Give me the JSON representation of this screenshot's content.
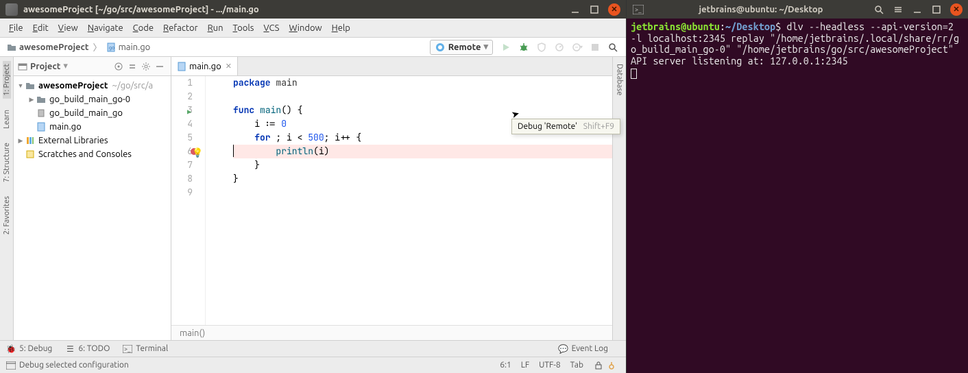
{
  "ide": {
    "title": "awesomeProject [~/go/src/awesomeProject] - .../main.go",
    "menus": [
      "File",
      "Edit",
      "View",
      "Navigate",
      "Code",
      "Refactor",
      "Run",
      "Tools",
      "VCS",
      "Window",
      "Help"
    ],
    "breadcrumbs": [
      {
        "label": "awesomeProject",
        "icon": "folder-icon"
      },
      {
        "label": "main.go",
        "icon": "go-file-icon"
      }
    ],
    "run_config": {
      "label": "Remote",
      "icon": "go-remote-icon"
    },
    "toolbar_icons": [
      {
        "name": "run-button",
        "title": "Run",
        "color": "#59a869",
        "disabled": true
      },
      {
        "name": "debug-button",
        "title": "Debug",
        "color": "#499c54",
        "disabled": false
      },
      {
        "name": "coverage-button",
        "title": "Coverage",
        "color": "#888",
        "disabled": true
      },
      {
        "name": "profile-button",
        "title": "Profile",
        "color": "#888",
        "disabled": true
      },
      {
        "name": "attach-button",
        "title": "Attach",
        "color": "#888",
        "disabled": true
      },
      {
        "name": "stop-button",
        "title": "Stop",
        "color": "#888",
        "disabled": true
      },
      {
        "name": "search-button",
        "title": "Search Everywhere",
        "color": "#555",
        "disabled": false
      }
    ],
    "tooltip": {
      "text": "Debug 'Remote'",
      "shortcut": "Shift+F9"
    },
    "left_stripe": [
      {
        "label": "1: Project",
        "active": true
      },
      {
        "label": "Learn",
        "active": false
      },
      {
        "label": "7: Structure",
        "active": false
      },
      {
        "label": "2: Favorites",
        "active": false
      }
    ],
    "right_stripe": [
      {
        "label": "Database"
      }
    ],
    "project_panel": {
      "title": "Project",
      "tree": [
        {
          "depth": 0,
          "tw": "▼",
          "icon": "folder-icon",
          "label": "awesomeProject",
          "dim": "~/go/src/a",
          "bold": true
        },
        {
          "depth": 1,
          "tw": "▶",
          "icon": "folder-icon",
          "label": "go_build_main_go-0"
        },
        {
          "depth": 1,
          "tw": "",
          "icon": "binary-icon",
          "label": "go_build_main_go"
        },
        {
          "depth": 1,
          "tw": "",
          "icon": "go-file-icon",
          "label": "main.go"
        },
        {
          "depth": 0,
          "tw": "▶",
          "icon": "library-icon",
          "label": "External Libraries"
        },
        {
          "depth": 0,
          "tw": "",
          "icon": "scratch-icon",
          "label": "Scratches and Consoles"
        }
      ]
    },
    "editor": {
      "tab": "main.go",
      "lines": [
        {
          "n": 1,
          "html": "<span class='pkg'>package</span> <span class='ident'>main</span>"
        },
        {
          "n": 2,
          "html": ""
        },
        {
          "n": 3,
          "html": "<span class='kw'>func</span> <span class='fn'>main</span>() {",
          "run": true
        },
        {
          "n": 4,
          "html": "    i := <span class='num'>0</span>"
        },
        {
          "n": 5,
          "html": "    <span class='kw'>for</span> ; i &lt; <span class='num'>500</span>; i++ {"
        },
        {
          "n": 6,
          "html": "        <span class='fn'>println</span>(i)",
          "bp": true
        },
        {
          "n": 7,
          "html": "    }"
        },
        {
          "n": 8,
          "html": "}"
        },
        {
          "n": 9,
          "html": ""
        }
      ],
      "breadcrumb": "main()"
    },
    "bottom_bar": {
      "items": [
        {
          "icon": "debug-icon",
          "label": "5: Debug"
        },
        {
          "icon": "todo-icon",
          "label": "6: TODO"
        },
        {
          "icon": "terminal-icon",
          "label": "Terminal"
        }
      ],
      "right": {
        "icon": "event-log-icon",
        "label": "Event Log"
      }
    },
    "status_bar": {
      "left_icon": "window-icon",
      "message": "Debug selected configuration",
      "right": [
        "6:1",
        "LF",
        "UTF-8",
        "Tab"
      ],
      "lock_icon": "lock-icon",
      "inspect_icon": "inspector-icon"
    }
  },
  "terminal": {
    "title": "jetbrains@ubuntu: ~/Desktop",
    "prompt_user": "jetbrains@ubuntu",
    "prompt_path": "~/Desktop",
    "command": "dlv --headless --api-version=2 -l localhost:2345 replay \"/home/jetbrains/.local/share/rr/go_build_main_go-0\" \"/home/jetbrains/go/src/awesomeProject\"",
    "output": "API server listening at: 127.0.0.1:2345"
  }
}
